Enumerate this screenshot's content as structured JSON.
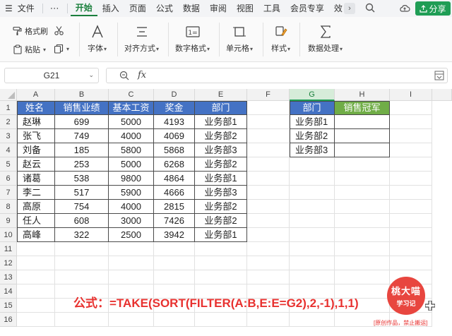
{
  "menu": {
    "file": "文件",
    "more": "⋯",
    "tabs": [
      "开始",
      "插入",
      "页面",
      "公式",
      "数据",
      "审阅",
      "视图",
      "工具",
      "会员专享",
      "效"
    ],
    "active_tab_index": 0,
    "share": "分享"
  },
  "ribbon": {
    "format_painter": "格式刷",
    "paste": "粘贴",
    "font": "字体",
    "alignment": "对齐方式",
    "number_format": "数字格式",
    "cell": "单元格",
    "style": "样式",
    "data_processing": "数据处理"
  },
  "formula_bar": {
    "cell_ref": "G21",
    "fx": "fx",
    "content": ""
  },
  "sheet": {
    "columns": [
      "A",
      "B",
      "C",
      "D",
      "E",
      "F",
      "G",
      "H",
      "I"
    ],
    "selected_column": "G",
    "rows": [
      "1",
      "2",
      "3",
      "4",
      "5",
      "6",
      "7",
      "8",
      "9",
      "10",
      "11",
      "12",
      "13",
      "14",
      "15",
      "16"
    ],
    "table1_header": [
      "姓名",
      "销售业绩",
      "基本工资",
      "奖金",
      "部门"
    ],
    "table1_rows": [
      [
        "赵琳",
        "699",
        "5000",
        "4193",
        "业务部1"
      ],
      [
        "张飞",
        "749",
        "4000",
        "4069",
        "业务部2"
      ],
      [
        "刘备",
        "185",
        "5800",
        "5868",
        "业务部3"
      ],
      [
        "赵云",
        "253",
        "5000",
        "6268",
        "业务部2"
      ],
      [
        "诸葛",
        "538",
        "9800",
        "4864",
        "业务部1"
      ],
      [
        "李二",
        "517",
        "5900",
        "4666",
        "业务部3"
      ],
      [
        "高原",
        "754",
        "4000",
        "2815",
        "业务部2"
      ],
      [
        "任人",
        "608",
        "3000",
        "7426",
        "业务部2"
      ],
      [
        "高峰",
        "322",
        "2500",
        "3942",
        "业务部1"
      ]
    ],
    "table2_header": [
      "部门",
      "销售冠军"
    ],
    "table2_rows": [
      [
        "业务部1",
        ""
      ],
      [
        "业务部2",
        ""
      ],
      [
        "业务部3",
        ""
      ]
    ]
  },
  "overlay": {
    "formula": "公式：=TAKE(SORT(FILTER(A:B,E:E=G2),2,-1),1,1)",
    "logo_line1": "桃大喵",
    "logo_line2": "学习记",
    "logo_note": "[原创作品，禁止搬运]"
  },
  "colors": {
    "accent_green": "#1a7f3c",
    "share_green": "#1f9d55",
    "header_blue": "#4472c4",
    "header_green": "#70ad47",
    "formula_red": "#e8312f"
  }
}
